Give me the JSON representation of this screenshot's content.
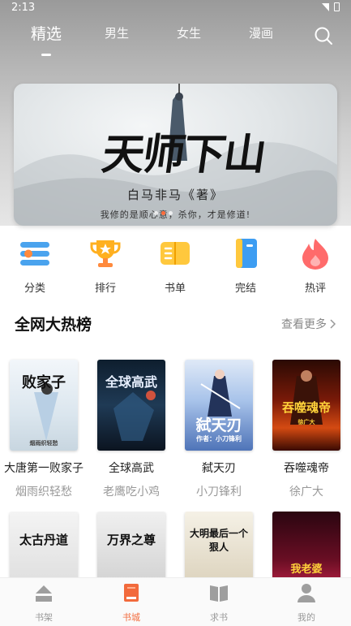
{
  "status_bar": {
    "time": "2:13"
  },
  "top_tabs": [
    {
      "label": "精选"
    },
    {
      "label": "男生"
    },
    {
      "label": "女生"
    },
    {
      "label": "漫画"
    }
  ],
  "banner": {
    "title": "天师下山",
    "author": "白马非马《著》",
    "tagline": "我修的是顺心意，杀你，才是修道!"
  },
  "categories": [
    {
      "label": "分类"
    },
    {
      "label": "排行"
    },
    {
      "label": "书单"
    },
    {
      "label": "完结"
    },
    {
      "label": "热评"
    }
  ],
  "hot_list": {
    "title": "全网大热榜",
    "more_label": "查看更多"
  },
  "books": [
    {
      "title": "大唐第一败家子",
      "author": "烟雨织轻愁",
      "cover_text": "败家子",
      "cover_credit": "烟雨织轻愁"
    },
    {
      "title": "全球高武",
      "author": "老鹰吃小鸡",
      "cover_text": "全球高武",
      "cover_credit": ""
    },
    {
      "title": "弑天刃",
      "author": "小刀锋利",
      "cover_text": "弑天刃",
      "cover_credit": "作者：小刀锋利"
    },
    {
      "title": "吞噬魂帝",
      "author": "徐广大",
      "cover_text": "吞噬魂帝",
      "cover_credit": "徐广大"
    }
  ],
  "books_row2": [
    {
      "cover_text": "太古丹道",
      "cover_credit": ""
    },
    {
      "cover_text": "万界之尊",
      "cover_credit": ""
    },
    {
      "cover_text": "大明最后一个狠人",
      "cover_credit": ""
    },
    {
      "cover_text": "我老婆",
      "cover_credit": ""
    }
  ],
  "bottom_nav": [
    {
      "label": "书架"
    },
    {
      "label": "书城"
    },
    {
      "label": "求书"
    },
    {
      "label": "我的"
    }
  ],
  "colors": {
    "accent": "#f26a3c",
    "nav_inactive": "#999999"
  }
}
